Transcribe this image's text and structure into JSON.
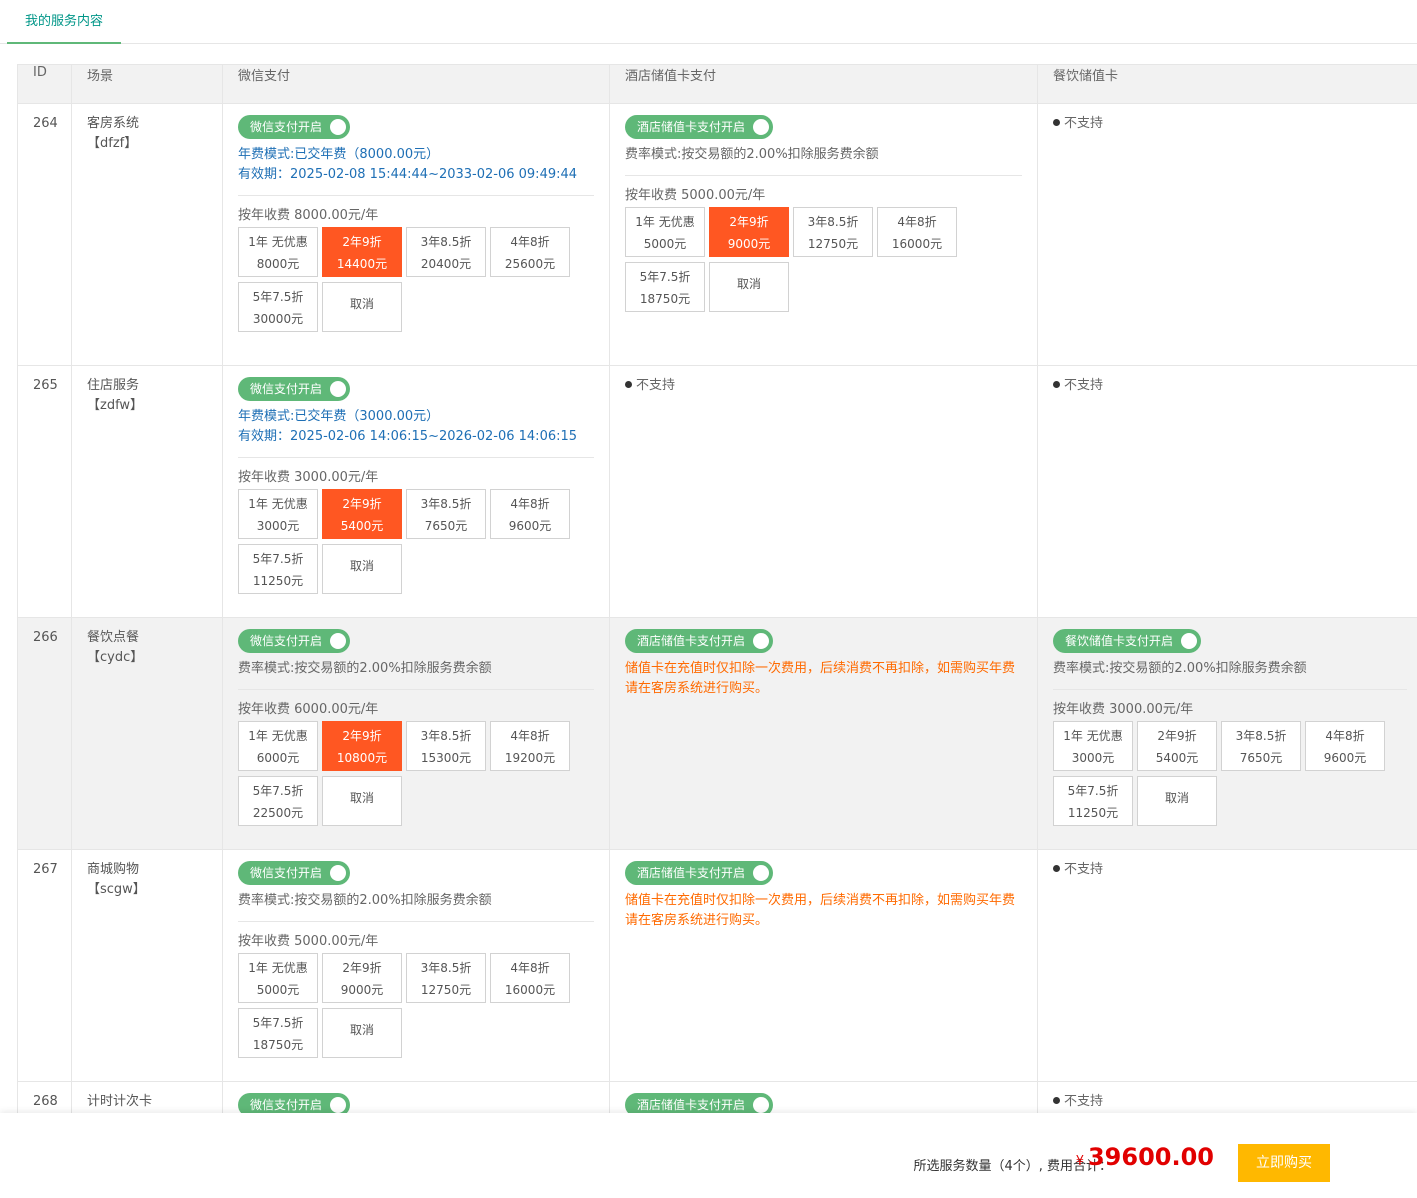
{
  "tab": {
    "label": "我的服务内容"
  },
  "columns": {
    "id": "ID",
    "scene": "场景",
    "wx": "微信支付",
    "hotel": "酒店储值卡支付",
    "food": "餐饮储值卡"
  },
  "common": {
    "not_supported": "不支持",
    "wx_toggle": "微信支付开启",
    "hotel_toggle": "酒店储值卡支付开启",
    "food_toggle": "餐饮储值卡支付开启",
    "rate_mode": "费率模式:按交易额的2.00%扣除服务费余额",
    "hotel_notice": "储值卡在充值时仅扣除一次费用，后续消费不再扣除，如需购买年费请在客房系统进行购买。",
    "cancel": "取消"
  },
  "rows": [
    {
      "id": "264",
      "scene": "客房系统",
      "code": "【dfzf】",
      "wx": {
        "fee_mode": "年费模式:已交年费（8000.00元）",
        "validity": "有效期：2025-02-08 15:44:44~2033-02-06 09:49:44",
        "price": "按年收费 8000.00元/年",
        "options": [
          {
            "t": "1年 无优惠",
            "p": "8000元"
          },
          {
            "t": "2年9折",
            "p": "14400元"
          },
          {
            "t": "3年8.5折",
            "p": "20400元"
          },
          {
            "t": "4年8折",
            "p": "25600元"
          },
          {
            "t": "5年7.5折",
            "p": "30000元"
          }
        ]
      },
      "hotel": {
        "price": "按年收费 5000.00元/年",
        "options": [
          {
            "t": "1年 无优惠",
            "p": "5000元"
          },
          {
            "t": "2年9折",
            "p": "9000元"
          },
          {
            "t": "3年8.5折",
            "p": "12750元"
          },
          {
            "t": "4年8折",
            "p": "16000元"
          },
          {
            "t": "5年7.5折",
            "p": "18750元"
          }
        ]
      }
    },
    {
      "id": "265",
      "scene": "住店服务",
      "code": "【zdfw】",
      "wx": {
        "fee_mode": "年费模式:已交年费（3000.00元）",
        "validity": "有效期：2025-02-06 14:06:15~2026-02-06 14:06:15",
        "price": "按年收费 3000.00元/年",
        "options": [
          {
            "t": "1年 无优惠",
            "p": "3000元"
          },
          {
            "t": "2年9折",
            "p": "5400元"
          },
          {
            "t": "3年8.5折",
            "p": "7650元"
          },
          {
            "t": "4年8折",
            "p": "9600元"
          },
          {
            "t": "5年7.5折",
            "p": "11250元"
          }
        ]
      }
    },
    {
      "id": "266",
      "scene": "餐饮点餐",
      "code": "【cydc】",
      "wx": {
        "price": "按年收费 6000.00元/年",
        "options": [
          {
            "t": "1年 无优惠",
            "p": "6000元"
          },
          {
            "t": "2年9折",
            "p": "10800元"
          },
          {
            "t": "3年8.5折",
            "p": "15300元"
          },
          {
            "t": "4年8折",
            "p": "19200元"
          },
          {
            "t": "5年7.5折",
            "p": "22500元"
          }
        ]
      },
      "food": {
        "price": "按年收费 3000.00元/年",
        "options": [
          {
            "t": "1年 无优惠",
            "p": "3000元"
          },
          {
            "t": "2年9折",
            "p": "5400元"
          },
          {
            "t": "3年8.5折",
            "p": "7650元"
          },
          {
            "t": "4年8折",
            "p": "9600元"
          },
          {
            "t": "5年7.5折",
            "p": "11250元"
          }
        ]
      }
    },
    {
      "id": "267",
      "scene": "商城购物",
      "code": "【scgw】",
      "wx": {
        "price": "按年收费 5000.00元/年",
        "options": [
          {
            "t": "1年 无优惠",
            "p": "5000元"
          },
          {
            "t": "2年9折",
            "p": "9000元"
          },
          {
            "t": "3年8.5折",
            "p": "12750元"
          },
          {
            "t": "4年8折",
            "p": "16000元"
          },
          {
            "t": "5年7.5折",
            "p": "18750元"
          }
        ]
      }
    },
    {
      "id": "268",
      "scene": "计时计次卡"
    }
  ],
  "footer": {
    "summary": "所选服务数量（4个）, 费用合计：",
    "currency": "¥",
    "total": "39600.00",
    "buy": "立即购买"
  }
}
